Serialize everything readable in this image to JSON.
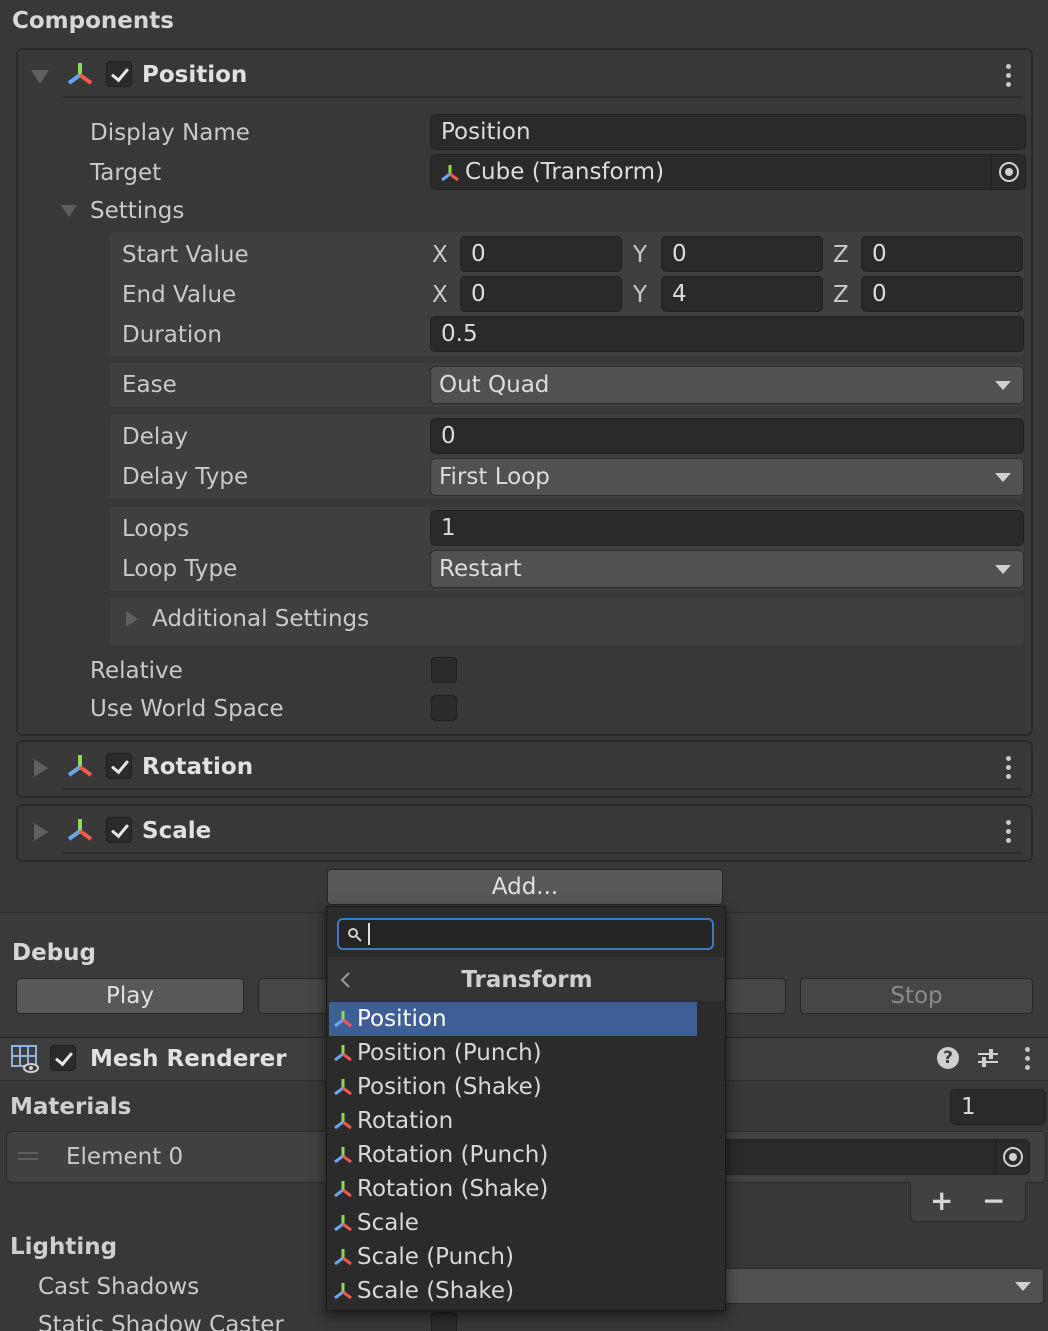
{
  "header": {
    "title": "Components"
  },
  "position_component": {
    "title": "Position",
    "enabled": true,
    "display_name_label": "Display Name",
    "display_name_value": "Position",
    "target_label": "Target",
    "target_value": "Cube (Transform)",
    "settings_label": "Settings",
    "start_value_label": "Start Value",
    "start_value": {
      "x": "0",
      "y": "0",
      "z": "0"
    },
    "end_value_label": "End Value",
    "end_value": {
      "x": "0",
      "y": "4",
      "z": "0"
    },
    "axis_x": "X",
    "axis_y": "Y",
    "axis_z": "Z",
    "duration_label": "Duration",
    "duration_value": "0.5",
    "ease_label": "Ease",
    "ease_value": "Out Quad",
    "delay_label": "Delay",
    "delay_value": "0",
    "delay_type_label": "Delay Type",
    "delay_type_value": "First Loop",
    "loops_label": "Loops",
    "loops_value": "1",
    "loop_type_label": "Loop Type",
    "loop_type_value": "Restart",
    "additional_settings_label": "Additional Settings",
    "relative_label": "Relative",
    "use_world_space_label": "Use World Space"
  },
  "rotation_component": {
    "title": "Rotation",
    "enabled": true
  },
  "scale_component": {
    "title": "Scale",
    "enabled": true
  },
  "add_button": {
    "label": "Add..."
  },
  "debug": {
    "title": "Debug",
    "play_label": "Play",
    "stop_label": "Stop"
  },
  "mesh_renderer": {
    "title": "Mesh Renderer",
    "enabled": true,
    "materials_label": "Materials",
    "materials_count": "1",
    "element_label": "Element 0",
    "plus": "+",
    "minus": "−",
    "lighting_label": "Lighting",
    "cast_shadows_label": "Cast Shadows",
    "static_shadow_label": "Static Shadow Caster"
  },
  "popup": {
    "search_value": "",
    "category_title": "Transform",
    "items": [
      "Position",
      "Position (Punch)",
      "Position (Shake)",
      "Rotation",
      "Rotation (Punch)",
      "Rotation (Shake)",
      "Scale",
      "Scale (Punch)",
      "Scale (Shake)"
    ],
    "selected_index": 0
  },
  "colors": {
    "background": "#383838",
    "field": "#2a2a2a",
    "selection": "#3e5f96",
    "popup": "#2b2b2b"
  },
  "icons": [
    "transform-icon",
    "kebab-menu-icon",
    "object-picker-icon",
    "search-icon",
    "back-arrow-icon",
    "help-icon",
    "preset-icon",
    "mesh-renderer-icon",
    "drag-handle-icon"
  ]
}
